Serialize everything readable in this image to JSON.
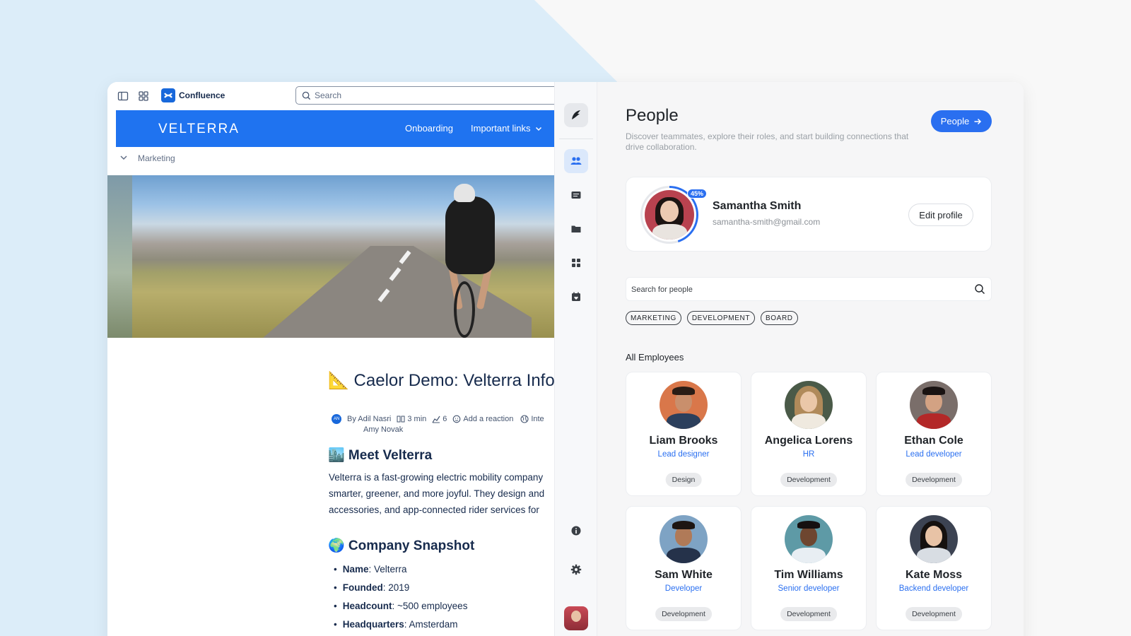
{
  "confluence": {
    "app_name": "Confluence",
    "search_placeholder": "Search",
    "brand": "VELTERRA",
    "nav": [
      "Onboarding",
      "Important links"
    ],
    "breadcrumb": "Marketing",
    "title": "📐 Caelor Demo: Velterra Inforr",
    "meta": {
      "avatar_initials": "AN",
      "author": "By Adil Nasri",
      "coauthor": "Amy Novak",
      "read_time": "3 min",
      "views": "6",
      "reaction": "Add a reaction",
      "extra": "Inte"
    },
    "section1_title": "🏙️ Meet Velterra",
    "section1_lines": [
      "Velterra is a fast-growing electric mobility company",
      "smarter, greener, and more joyful. They design and",
      "accessories, and app-connected rider services for"
    ],
    "section2_title": "🌍 Company Snapshot",
    "snapshot": [
      {
        "k": "Name",
        "v": ": Velterra"
      },
      {
        "k": "Founded",
        "v": ": 2019"
      },
      {
        "k": "Headcount",
        "v": ": ~500 employees"
      },
      {
        "k": "Headquarters",
        "v": ": Amsterdam"
      }
    ]
  },
  "rail": {
    "items": [
      "people-icon",
      "message-icon",
      "folder-icon",
      "grid-icon",
      "calendar-heart-icon",
      "info-icon",
      "gear-icon"
    ]
  },
  "people": {
    "title": "People",
    "subtitle": "Discover teammates, explore their roles, and start building connections that drive collaboration.",
    "button_label": "People",
    "profile": {
      "name": "Samantha Smith",
      "email": "samantha-smith@gmail.com",
      "completion": "45%",
      "completion_value": 0.45,
      "edit_label": "Edit profile"
    },
    "search_placeholder": "Search for people",
    "filters": [
      "MARKETING",
      "DEVELOPMENT",
      "BOARD"
    ],
    "section_title": "All Employees",
    "employees": [
      {
        "name": "Liam Brooks",
        "role": "Lead designer",
        "team": "Design"
      },
      {
        "name": "Angelica Lorens",
        "role": "HR",
        "team": "Development"
      },
      {
        "name": "Ethan Cole",
        "role": "Lead developer",
        "team": "Development"
      },
      {
        "name": "Sam White",
        "role": "Developer",
        "team": "Development"
      },
      {
        "name": "Tim Williams",
        "role": "Senior developer",
        "team": "Development"
      },
      {
        "name": "Kate Moss",
        "role": "Backend developer",
        "team": "Development"
      }
    ]
  },
  "colors": {
    "accent": "#2a6ff0",
    "banner": "#1f73f0",
    "background_tint": "#dcedf9"
  }
}
